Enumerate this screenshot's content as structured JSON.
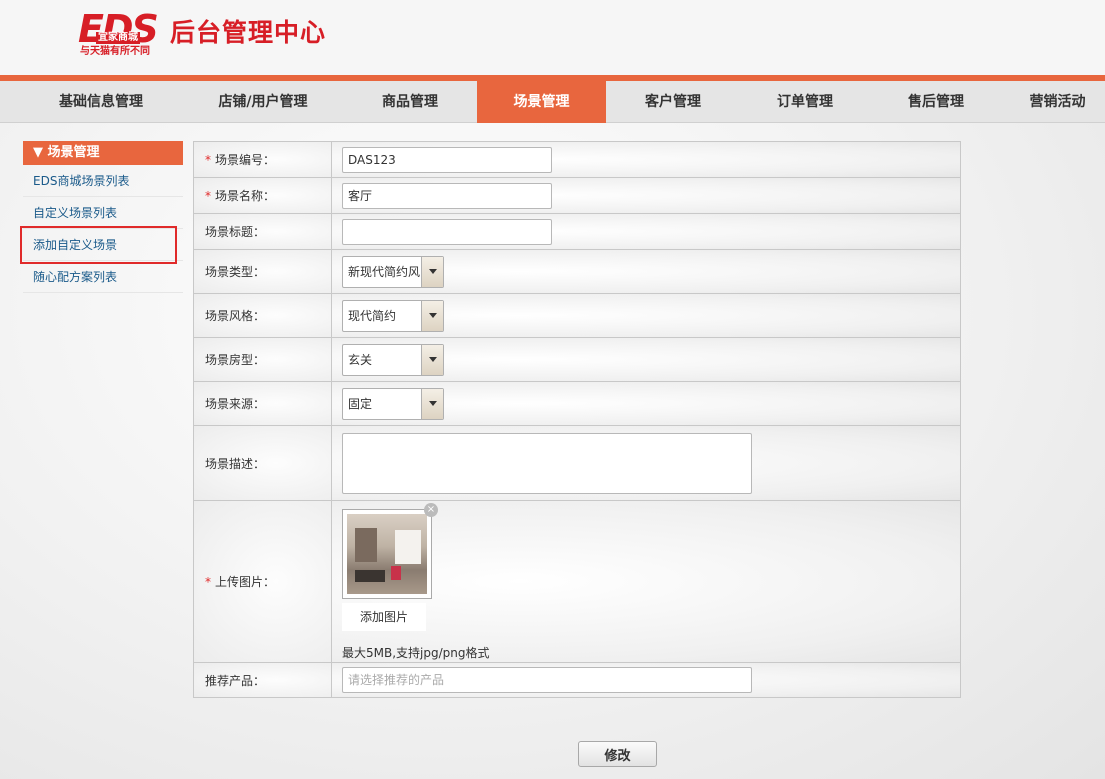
{
  "header": {
    "logo_text": "EDS",
    "logo_sub": "宜家商城",
    "slogan": "与天猫有所不同",
    "title": "后台管理中心",
    "brand_color": "#d71e26"
  },
  "nav": {
    "accent_color": "#e8663e",
    "items": [
      {
        "label": "基础信息管理"
      },
      {
        "label": "店铺/用户管理"
      },
      {
        "label": "商品管理"
      },
      {
        "label": "场景管理"
      },
      {
        "label": "客户管理"
      },
      {
        "label": "订单管理"
      },
      {
        "label": "售后管理"
      },
      {
        "label": "营销活动"
      }
    ],
    "active_index": 3
  },
  "sidebar": {
    "heading": "▼ 场景管理",
    "items": [
      {
        "label": "EDS商城场景列表"
      },
      {
        "label": "自定义场景列表"
      },
      {
        "label": "添加自定义场景"
      },
      {
        "label": "随心配方案列表"
      }
    ],
    "highlighted_index": 2
  },
  "form": {
    "code": {
      "label": "场景编号：",
      "value": "DAS123"
    },
    "name": {
      "label": "场景名称：",
      "value": "客厅"
    },
    "title": {
      "label": "场景标题：",
      "value": ""
    },
    "type": {
      "label": "场景类型：",
      "value": "新现代简约风"
    },
    "style": {
      "label": "场景风格：",
      "value": "现代简约"
    },
    "room": {
      "label": "场景房型：",
      "value": "玄关"
    },
    "source": {
      "label": "场景来源：",
      "value": "固定"
    },
    "desc": {
      "label": "场景描述：",
      "value": ""
    },
    "upload": {
      "label": "上传图片：",
      "add_label": "添加图片",
      "hint": "最大5MB,支持jpg/png格式",
      "remove_glyph": "×"
    },
    "product": {
      "label": "推荐产品：",
      "placeholder": "请选择推荐的产品"
    },
    "required_mark": "*"
  },
  "submit_label": "修改"
}
